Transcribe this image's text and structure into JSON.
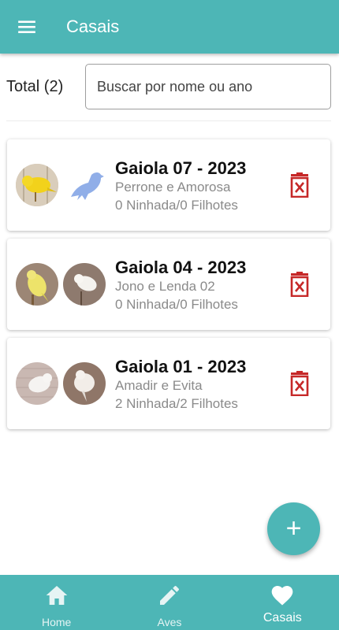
{
  "appbar": {
    "title": "Casais",
    "menu_icon": "menu-icon"
  },
  "search": {
    "total_label": "Total (2)",
    "placeholder": "Buscar por nome ou ano"
  },
  "couples": [
    {
      "title": "Gaiola 07 - 2023",
      "names": "Perrone e Amorosa",
      "stats": "0 Ninhada/0 Filhotes"
    },
    {
      "title": "Gaiola 04 - 2023",
      "names": "Jono e Lenda 02",
      "stats": "0 Ninhada/0 Filhotes"
    },
    {
      "title": "Gaiola 01 - 2023",
      "names": "Amadir e Evita",
      "stats": "2 Ninhada/2 Filhotes"
    }
  ],
  "fab": {
    "label": "+"
  },
  "bottom_nav": [
    {
      "label": "Home",
      "icon": "home-icon"
    },
    {
      "label": "Aves",
      "icon": "pencil-icon"
    },
    {
      "label": "Casais",
      "icon": "heart-icon",
      "active": true
    }
  ],
  "colors": {
    "primary": "#4db6b6",
    "delete": "#c62828",
    "placeholder_bird": "#90aee8"
  }
}
